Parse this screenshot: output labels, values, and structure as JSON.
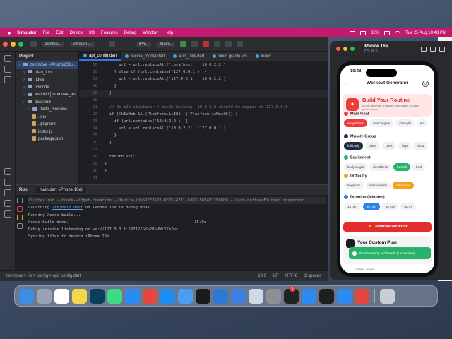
{
  "menubar": {
    "items": [
      "Simulator",
      "File",
      "Edit",
      "Device",
      "I/O",
      "Features",
      "Debug",
      "Window",
      "Help"
    ],
    "battery": "82%",
    "datetime": "Tue 25 Aug  10:48 PM"
  },
  "ide": {
    "toolbar": {
      "project_chip": "zenmo...",
      "version_chip": "Version ...",
      "device_chip": "iPh...",
      "run_chip": "main..."
    },
    "project": {
      "header": "Project",
      "tree": [
        {
          "label": "zenmove ~/AndroidStu...",
          "kind": "folder",
          "indent": 0
        },
        {
          "label": ".dart_tool",
          "kind": "folder",
          "indent": 1
        },
        {
          "label": ".idea",
          "kind": "folder",
          "indent": 1
        },
        {
          "label": ".vscode",
          "kind": "folder",
          "indent": 1
        },
        {
          "label": "android [zenmove_an...",
          "kind": "folder",
          "indent": 1
        },
        {
          "label": "backend",
          "kind": "folder",
          "indent": 1
        },
        {
          "label": "node_modules",
          "kind": "folder",
          "indent": 2
        },
        {
          "label": ".env",
          "kind": "file",
          "indent": 2
        },
        {
          "label": ".gitignore",
          "kind": "file",
          "indent": 2
        },
        {
          "label": "index.js",
          "kind": "file",
          "indent": 2
        },
        {
          "label": "package.json",
          "kind": "file",
          "indent": 2
        }
      ]
    },
    "tabs": [
      {
        "label": "api_config.dart",
        "active": true
      },
      {
        "label": "recipe_model.dart",
        "active": false
      },
      {
        "label": "app_utils.dart",
        "active": false
      },
      {
        "label": "build.gradle.kts",
        "active": false
      },
      {
        "label": "index",
        "active": false
      }
    ],
    "code": [
      {
        "ln": "15",
        "text": "      url = url.replaceAll('localhost', '10.0.2.2');"
      },
      {
        "ln": "16",
        "text": "    } else if (url.contains('127.0.0.1')) {"
      },
      {
        "ln": "17",
        "text": "      url = url.replaceAll('127.0.0.1', '10.0.2.2');"
      },
      {
        "ln": "18",
        "text": "    }"
      },
      {
        "ln": "19",
        "text": "  }"
      },
      {
        "ln": "20",
        "text": ""
      },
      {
        "ln": "21",
        "text": "  // On iOS simulator / macOS desktop, 10.0.2.2 should be mapped to 127.0.0.1"
      },
      {
        "ln": "22",
        "text": "  if (!kIsWeb && (Platform.isIOS || Platform.isMacOS)) {"
      },
      {
        "ln": "23",
        "text": "    if (url.contains('10.0.2.2')) {"
      },
      {
        "ln": "24",
        "text": "      url = url.replaceAll('10.0.2.2', '127.0.0.1');"
      },
      {
        "ln": "25",
        "text": "    }"
      },
      {
        "ln": "26",
        "text": "  }"
      },
      {
        "ln": "27",
        "text": ""
      },
      {
        "ln": "28",
        "text": "  return url;"
      },
      {
        "ln": "29",
        "text": "}"
      },
      {
        "ln": "30",
        "text": "}"
      },
      {
        "ln": "31",
        "text": ""
      }
    ],
    "run": {
      "label": "Run",
      "tab": "main.dart (iPhone 16e)",
      "lines": [
        {
          "text": "flutter run --track-widget-creation --device-id=59FF3A02-DF75-47F1-83D3-588AE12E8800 --dart-define=Flutter.inspector",
          "cmd": true
        },
        {
          "pre": "Launching ",
          "link": "lib/main.dart",
          "post": " on iPhone 16e in debug mode..."
        },
        {
          "text": "Running Xcode build..."
        },
        {
          "text": "Xcode build done.",
          "tail": "15.0s"
        },
        {
          "text": "Debug service listening on ws://127.0.0.1:50712/GKo2UnVWtXY=/ws"
        },
        {
          "text": "Syncing files to device iPhone 16e..."
        }
      ]
    },
    "status": {
      "breadcrumb": "zenmove  >  lib  >  config  >  api_config.dart",
      "position": "19:6",
      "line_ending": "LF",
      "encoding": "UTF-8",
      "indent": "2 spaces"
    }
  },
  "simulator": {
    "device_name": "iPhone 16e",
    "os": "iOS 26.0",
    "status_time": "10:48",
    "app": {
      "title": "Workout Generator",
      "hero_title": "Build Your Routine",
      "hero_subtitle": "AI will generate a custom plan based on your preferences.",
      "sections": [
        {
          "title": "Main Goal",
          "color": "#ef3b3b",
          "chips": [
            {
              "label": "weight loss",
              "style": "red"
            },
            {
              "label": "muscle gain",
              "style": ""
            },
            {
              "label": "strength",
              "style": ""
            },
            {
              "label": "en",
              "style": ""
            }
          ]
        },
        {
          "title": "Muscle Group",
          "color": "#1f2a44",
          "chips": [
            {
              "label": "full body",
              "style": "navy"
            },
            {
              "label": "chest",
              "style": ""
            },
            {
              "label": "back",
              "style": ""
            },
            {
              "label": "legs",
              "style": ""
            },
            {
              "label": "shoul",
              "style": ""
            }
          ]
        },
        {
          "title": "Equipment",
          "color": "#27b36a",
          "chips": [
            {
              "label": "bodyweight",
              "style": ""
            },
            {
              "label": "dumbbells",
              "style": ""
            },
            {
              "label": "barbell",
              "style": "green"
            },
            {
              "label": "kettl",
              "style": ""
            }
          ]
        },
        {
          "title": "Difficulty",
          "color": "#f2a31b",
          "chips": [
            {
              "label": "beginner",
              "style": ""
            },
            {
              "label": "intermediate",
              "style": ""
            },
            {
              "label": "advanced",
              "style": "orange"
            }
          ]
        },
        {
          "title": "Duration (Minutes)",
          "color": "#2f80ed",
          "chips": [
            {
              "label": "15 min",
              "style": ""
            },
            {
              "label": "30 min",
              "style": "blue"
            },
            {
              "label": "45 min",
              "style": ""
            },
            {
              "label": "60 mi",
              "style": ""
            }
          ]
        }
      ],
      "generate_button": "Generate Workout",
      "plan_title": "Your Custom Plan",
      "toast": "Routine ready and saved! (1 exercises)",
      "peek": "5 Sets   ·   Reps"
    }
  },
  "dock": {
    "apps": [
      "Finder",
      "Launchpad",
      "Calendar",
      "Notes",
      "Instruments",
      "Android Studio",
      "Safari",
      "Chrome",
      "App Store",
      "Mail",
      "Terminal",
      "VS Code",
      "Xcode",
      "Preview",
      "System Settings",
      "Terminal",
      "Simulator",
      "Cursor",
      "Safari",
      "Chrome",
      "Trash"
    ],
    "badge": "3",
    "colors": [
      "#3a8ee6",
      "#9aa3b3",
      "#ffffff",
      "#f3d84a",
      "#0b3d5c",
      "#3ddc84",
      "#2a8cf0",
      "#e8453c",
      "#1c8df2",
      "#4a9df0",
      "#1b1b1b",
      "#2c7ad6",
      "#3d7fe0",
      "#cfd8e3",
      "#8e8e93",
      "#222222",
      "#2a8cf0",
      "#1e1e1e",
      "#2a8cf0",
      "#e8453c",
      "#c9ced6"
    ]
  }
}
